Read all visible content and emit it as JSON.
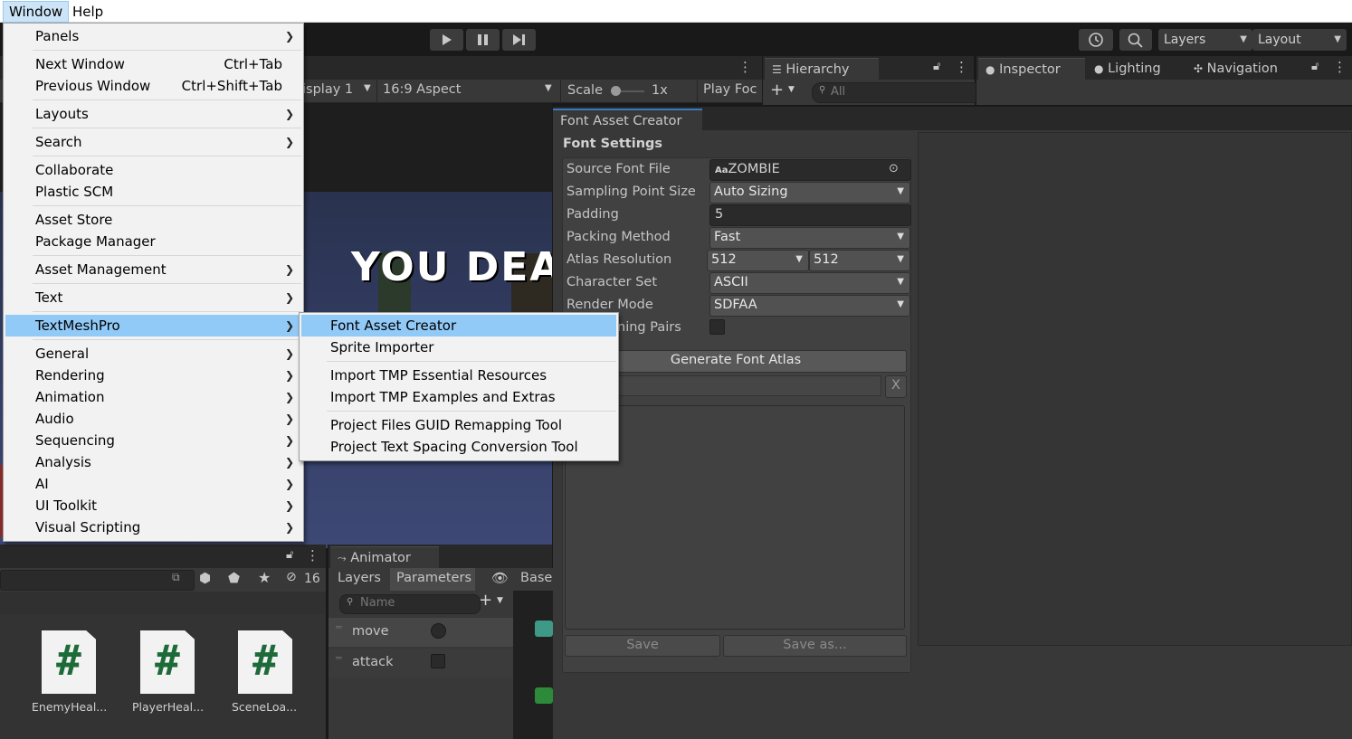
{
  "menubar": {
    "items": [
      "Window",
      "Help"
    ]
  },
  "toolbar": {
    "layers_label": "Layers",
    "layout_label": "Layout"
  },
  "game_view": {
    "display": "isplay 1",
    "aspect": "16:9 Aspect",
    "scale_label": "Scale",
    "scale_value": "1x",
    "play_focus": "Play Foc",
    "game_text": "YOU DEA"
  },
  "hierarchy": {
    "tab": "Hierarchy",
    "search_placeholder": "All"
  },
  "inspector_tabs": [
    "Inspector",
    "Lighting",
    "Navigation"
  ],
  "font_asset_creator": {
    "tab": "Font Asset Creator",
    "section": "Font Settings",
    "rows": [
      {
        "label": "Source Font File",
        "value": "ZOMBIE",
        "badge": "Aa"
      },
      {
        "label": "Sampling Point Size",
        "value": "Auto Sizing"
      },
      {
        "label": "Padding",
        "value": "5"
      },
      {
        "label": "Packing Method",
        "value": "Fast"
      },
      {
        "label": "Atlas Resolution",
        "value": "512",
        "value2": "512"
      },
      {
        "label": "Character Set",
        "value": "ASCII"
      },
      {
        "label": "Render Mode",
        "value": "SDFAA"
      },
      {
        "label": "ning Pairs"
      }
    ],
    "generate_button": "Generate Font Atlas",
    "clear_button": "X",
    "save_button": "Save",
    "save_as_button": "Save as..."
  },
  "project": {
    "hidden_count": "16",
    "files": [
      "EnemyHeal...",
      "PlayerHeal...",
      "SceneLoa..."
    ]
  },
  "animator": {
    "tab": "Animator",
    "subtabs": [
      "Layers",
      "Parameters"
    ],
    "base_label": "Base",
    "search_placeholder": "Name",
    "params": [
      "move",
      "attack"
    ]
  },
  "window_menu": {
    "items": [
      {
        "label": "Panels",
        "submenu": true
      },
      {
        "label": "Next Window",
        "shortcut": "Ctrl+Tab"
      },
      {
        "label": "Previous Window",
        "shortcut": "Ctrl+Shift+Tab"
      },
      {
        "label": "Layouts",
        "submenu": true
      },
      {
        "label": "Search",
        "submenu": true
      },
      {
        "label": "Collaborate"
      },
      {
        "label": "Plastic SCM"
      },
      {
        "label": "Asset Store"
      },
      {
        "label": "Package Manager"
      },
      {
        "label": "Asset Management",
        "submenu": true
      },
      {
        "label": "Text",
        "submenu": true
      },
      {
        "label": "TextMeshPro",
        "submenu": true,
        "highlighted": true
      },
      {
        "label": "General",
        "submenu": true
      },
      {
        "label": "Rendering",
        "submenu": true
      },
      {
        "label": "Animation",
        "submenu": true
      },
      {
        "label": "Audio",
        "submenu": true
      },
      {
        "label": "Sequencing",
        "submenu": true
      },
      {
        "label": "Analysis",
        "submenu": true
      },
      {
        "label": "AI",
        "submenu": true
      },
      {
        "label": "UI Toolkit",
        "submenu": true
      },
      {
        "label": "Visual Scripting",
        "submenu": true
      }
    ]
  },
  "textmeshpro_submenu": {
    "items": [
      {
        "label": "Font Asset Creator",
        "highlighted": true
      },
      {
        "label": "Sprite Importer"
      },
      {
        "label": "Import TMP Essential Resources"
      },
      {
        "label": "Import TMP Examples and Extras"
      },
      {
        "label": "Project Files GUID Remapping Tool"
      },
      {
        "label": "Project Text Spacing Conversion Tool"
      }
    ]
  },
  "colors": {
    "menu_highlight": "#91c9f7",
    "unity_dark": "#191919",
    "panel": "#383838",
    "script_green": "#1e6b3a"
  }
}
